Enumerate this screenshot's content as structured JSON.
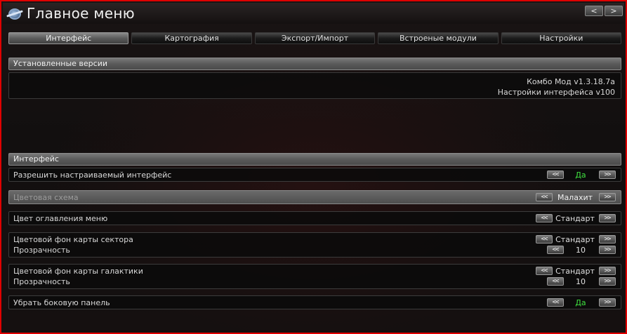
{
  "window": {
    "title": "Главное меню"
  },
  "nav": {
    "back": "<",
    "forward": ">"
  },
  "tabs": [
    "Интерфейс",
    "Картография",
    "Экспорт/Импорт",
    "Встроеные модули",
    "Настройки"
  ],
  "versions": {
    "header": "Установленные версии",
    "lines": [
      "Комбо Мод v1.3.18.7a",
      "Настройки интерфейса v100"
    ]
  },
  "interface": {
    "header": "Интерфейс",
    "arrow_left": "<<",
    "arrow_right": ">>",
    "rows": [
      {
        "label": "Разрешить настраиваемый интерфейс",
        "value": "Да"
      },
      {
        "label": "Цветовая схема",
        "value": "Малахит"
      },
      {
        "label": "Цвет оглавления меню",
        "value": "Стандарт"
      },
      {
        "label": "Цветовой фон карты сектора",
        "value": "Стандарт",
        "sub_label": "Прозрачность",
        "sub_value": "10"
      },
      {
        "label": "Цветовой фон карты галактики",
        "value": "Стандарт",
        "sub_label": "Прозрачность",
        "sub_value": "10"
      },
      {
        "label": "Убрать боковую панель",
        "value": "Да"
      }
    ]
  },
  "colors": {
    "frame": "#e00000",
    "accent_green": "#3fe03f"
  }
}
